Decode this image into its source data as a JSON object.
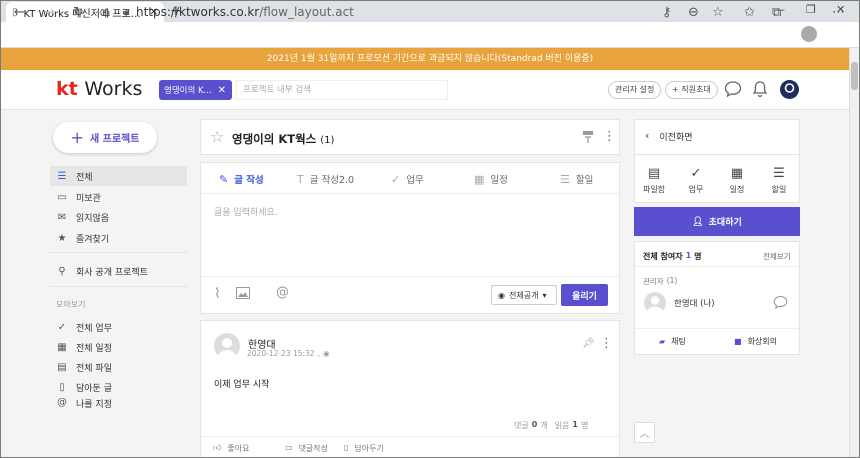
{
  "browser": {
    "tab_title": "KT Works 메신저에 프로젝트 협업",
    "new_tab": "+",
    "url_host": "https://ktworks.co.kr",
    "url_path": "/flow_layout.act"
  },
  "banner": {
    "text": "2021년 1월 31일까지 프로모션 기간으로 과금되지 않습니다(Standrad 버전 이용중)"
  },
  "header": {
    "logo_kt": "kt",
    "logo_works": "Works",
    "project_chip": "영댕이의 K...",
    "project_chip_close": "✕",
    "search_placeholder": "프로젝트 내부 검색",
    "admin_btn": "관리자 설정",
    "invite_btn": "+ 직원초대"
  },
  "sidebar": {
    "new_project": "새 프로젝트",
    "items": [
      {
        "label": "전체",
        "icon": "☰"
      },
      {
        "label": "미보관",
        "icon": "▭"
      },
      {
        "label": "읽지않음",
        "icon": "✉"
      },
      {
        "label": "즐겨찾기",
        "icon": "★"
      }
    ],
    "company_projects": "회사 공개 프로젝트",
    "section_title": "모아보기",
    "collect": [
      {
        "label": "전체 업무",
        "icon": "✓"
      },
      {
        "label": "전체 일정",
        "icon": "▦"
      },
      {
        "label": "전체 파일",
        "icon": "▤"
      },
      {
        "label": "담아둔 글",
        "icon": "▯"
      },
      {
        "label": "나를 지정",
        "icon": "@"
      }
    ]
  },
  "project": {
    "title": "영댕이의 KT웍스",
    "count": "(1)"
  },
  "composer": {
    "tabs": [
      "글 작성",
      "글 작성2.0",
      "업무",
      "일정",
      "할일"
    ],
    "placeholder": "글을 입력하세요.",
    "visibility": "전체공개",
    "submit": "올리기"
  },
  "post": {
    "author": "한영대",
    "time": "2020-12-23 15:32",
    "body": "이제 업무 시작",
    "comments_label": "댓글",
    "comments_count": "0",
    "comments_unit": "개",
    "read_label": "읽음",
    "read_count": "1",
    "read_unit": "명",
    "like": "좋아요",
    "comment": "댓글작성",
    "bookmark": "담아두기"
  },
  "right": {
    "back": "이전화면",
    "quick": [
      "파일함",
      "업무",
      "일정",
      "할일"
    ],
    "invite": "초대하기",
    "members_label": "전체 참여자",
    "members_count": "1",
    "members_unit": "명",
    "view_all": "전체보기",
    "admin_label": "관리자",
    "admin_count": "(1)",
    "member_name": "한영대 (나)",
    "chat": "채팅",
    "video": "화상회의"
  },
  "colors": {
    "accent": "#5a4fcf",
    "banner": "#e8a33d",
    "link": "#3b5bdb"
  }
}
